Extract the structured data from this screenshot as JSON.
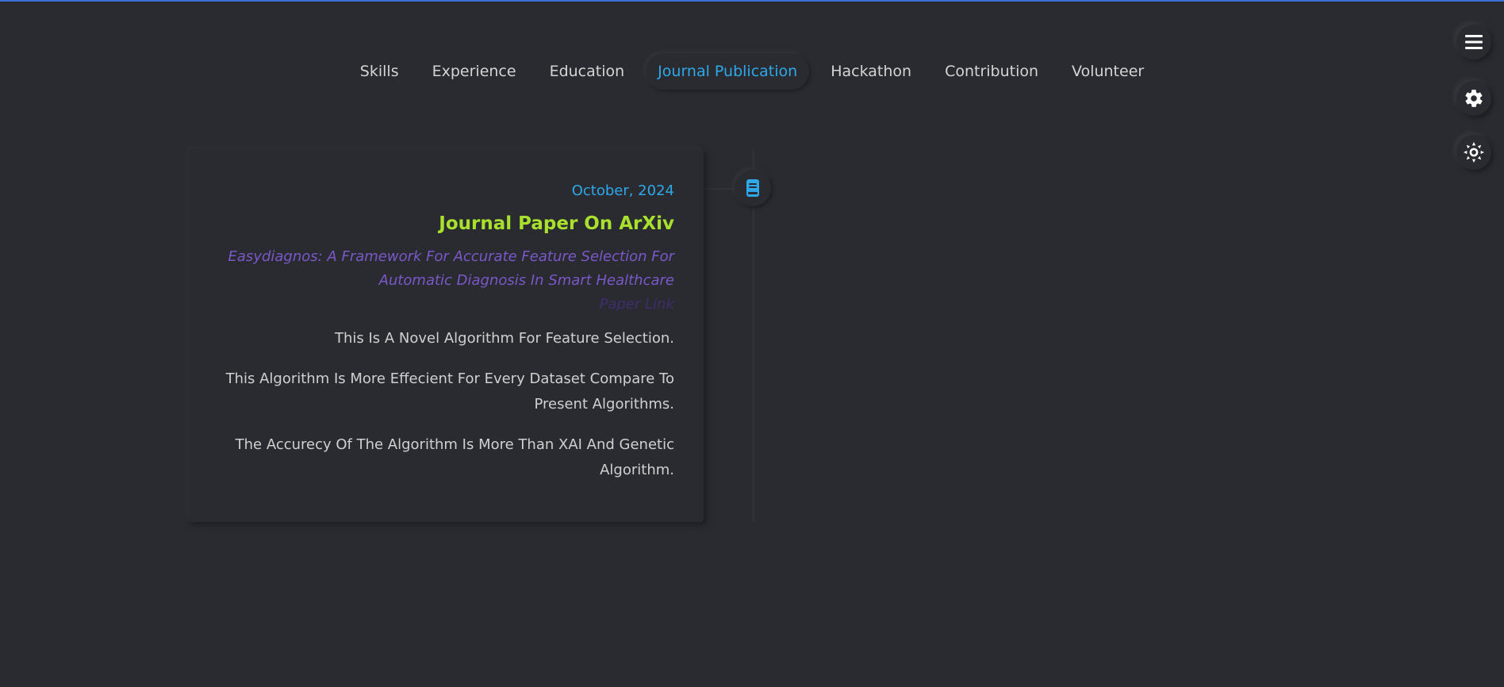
{
  "nav": {
    "tabs": [
      {
        "label": "Skills"
      },
      {
        "label": "Experience"
      },
      {
        "label": "Education"
      },
      {
        "label": "Journal Publication"
      },
      {
        "label": "Hackathon"
      },
      {
        "label": "Contribution"
      },
      {
        "label": "Volunteer"
      }
    ],
    "active_tab": "Journal Publication"
  },
  "side_buttons": [
    {
      "icon": "menu-icon"
    },
    {
      "icon": "gear-icon"
    },
    {
      "icon": "sun-icon"
    }
  ],
  "entry": {
    "date": "October, 2024",
    "title": "Journal Paper On ArXiv",
    "subtitle_line1": "Easydiagnos: A Framework For Accurate Feature Selection For",
    "subtitle_line2": "Automatic Diagnosis In Smart Healthcare",
    "link_label": "Paper Link",
    "descriptions": [
      "This Is A Novel Algorithm For Feature Selection.",
      "This Algorithm Is More Effecient For Every Dataset Compare To Present Algorithms.",
      "The Accurecy Of The Algorithm Is More Than XAI And Genetic Algorithm."
    ],
    "timeline_icon": "book-icon"
  },
  "colors": {
    "background": "#2a2b30",
    "accent_blue": "#2ea8e8",
    "title_green": "#a8e02e",
    "subtitle_purple": "#7a58c9",
    "link_purple": "#3f2d6e",
    "top_bar": "#3b6fd6"
  }
}
